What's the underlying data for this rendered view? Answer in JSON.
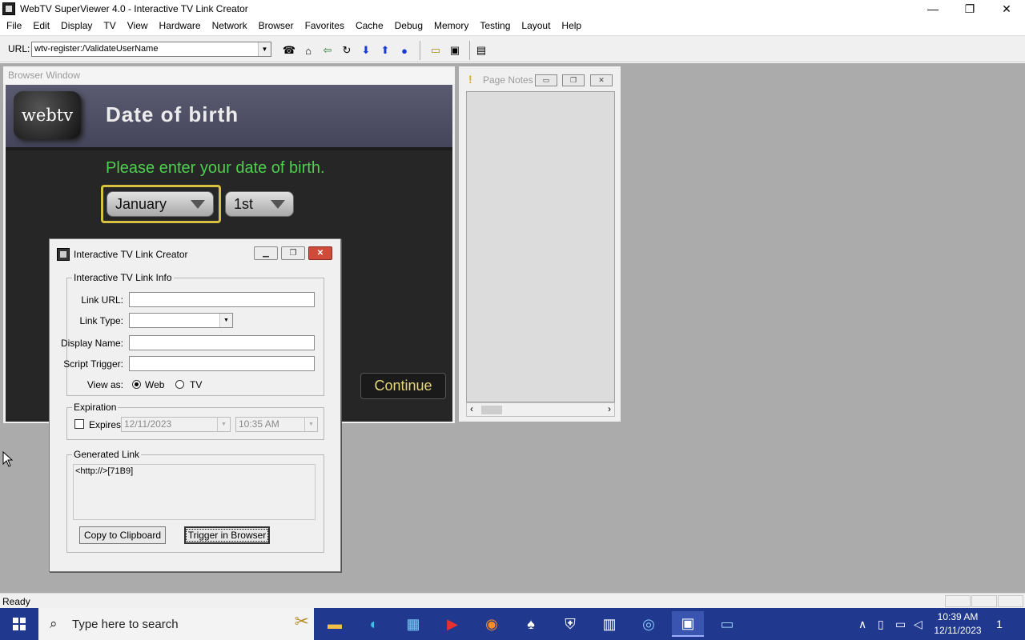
{
  "window": {
    "title": "WebTV SuperViewer 4.0 - Interactive TV Link Creator",
    "minimize": "—",
    "restore": "❐",
    "close": "✕"
  },
  "menu": [
    "File",
    "Edit",
    "Display",
    "TV",
    "View",
    "Hardware",
    "Network",
    "Browser",
    "Favorites",
    "Cache",
    "Debug",
    "Memory",
    "Testing",
    "Layout",
    "Help"
  ],
  "toolbar": {
    "url_label": "URL:",
    "url_value": "wtv-register:/ValidateUserName"
  },
  "browser_window": {
    "caption": "Browser Window",
    "logo_text": "webtv",
    "page_title": "Date of birth",
    "prompt": "Please enter your date of birth.",
    "month": "January",
    "day": "1st",
    "continue": "Continue"
  },
  "page_notes": {
    "caption": "Page Notes"
  },
  "dialog": {
    "title": "Interactive TV Link Creator",
    "link_info_legend": "Interactive TV Link Info",
    "link_url_label": "Link URL:",
    "link_type_label": "Link Type:",
    "display_name_label": "Display Name:",
    "script_trigger_label": "Script Trigger:",
    "view_as_label": "View as:",
    "view_web": "Web",
    "view_tv": "TV",
    "expiration_legend": "Expiration",
    "expires_label": "Expires:",
    "expires_date": "12/11/2023",
    "expires_time": "10:35 AM",
    "generated_legend": "Generated Link",
    "generated_value": "<http://>[71B9]",
    "copy_button": "Copy to Clipboard",
    "trigger_button": "Trigger in Browser"
  },
  "status": {
    "text": "Ready"
  },
  "taskbar": {
    "search_placeholder": "Type here to search",
    "time": "10:39 AM",
    "date": "12/11/2023",
    "notification_count": "1"
  }
}
